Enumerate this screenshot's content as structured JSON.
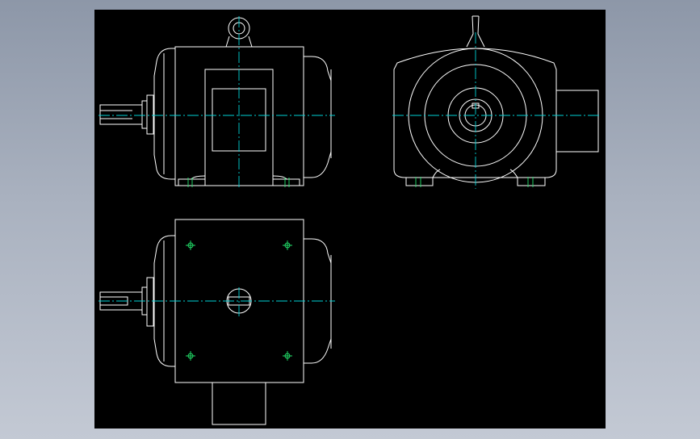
{
  "viewer": {
    "background": "#000000",
    "outer_background": "#a9b1bf"
  },
  "colors": {
    "outline": "#ffffff",
    "centerline": "#00d2d6",
    "bolt_holes": "#22e06a"
  },
  "drawing": {
    "views": [
      "front-view",
      "side-view",
      "top-view"
    ]
  }
}
